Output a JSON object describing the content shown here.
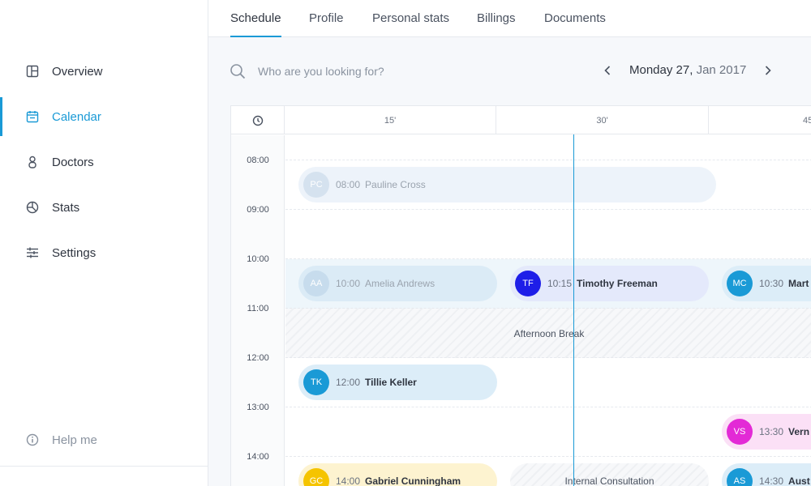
{
  "sidebar": {
    "items": [
      {
        "label": "Overview",
        "icon": "layout-icon"
      },
      {
        "label": "Calendar",
        "icon": "calendar-icon",
        "active": true
      },
      {
        "label": "Doctors",
        "icon": "person-icon"
      },
      {
        "label": "Stats",
        "icon": "pie-chart-icon"
      },
      {
        "label": "Settings",
        "icon": "sliders-icon"
      }
    ],
    "help": {
      "label": "Help me",
      "icon": "info-icon"
    }
  },
  "tabs": [
    {
      "label": "Schedule",
      "active": true
    },
    {
      "label": "Profile"
    },
    {
      "label": "Personal stats"
    },
    {
      "label": "Billings"
    },
    {
      "label": "Documents"
    }
  ],
  "search": {
    "placeholder": "Who are you looking for?",
    "value": ""
  },
  "date": {
    "day": "Monday 27,",
    "rest": "Jan 2017"
  },
  "calendar": {
    "minute_columns": [
      "15'",
      "30'",
      "45'"
    ],
    "hours": [
      "08:00",
      "09:00",
      "10:00",
      "11:00",
      "12:00",
      "13:00",
      "14:00"
    ],
    "break_label": "Afternoon Break",
    "appointments": [
      {
        "initials": "PC",
        "time": "08:00",
        "name": "Pauline Cross"
      },
      {
        "initials": "AA",
        "time": "10:00",
        "name": "Amelia Andrews"
      },
      {
        "initials": "TF",
        "time": "10:15",
        "name": "Timothy Freeman"
      },
      {
        "initials": "MC",
        "time": "10:30",
        "name": "Mart"
      },
      {
        "initials": "TK",
        "time": "12:00",
        "name": "Tillie Keller"
      },
      {
        "initials": "VS",
        "time": "13:30",
        "name": "Vern"
      },
      {
        "initials": "GC",
        "time": "14:00",
        "name": "Gabriel Cunningham"
      },
      {
        "initials": "AS",
        "time": "14:30",
        "name": "Aust"
      }
    ],
    "internal_label": "Internal Consultation"
  },
  "colors": {
    "accent": "#1a9ad6",
    "avatar_tf": "#1e1ee8",
    "avatar_mc": "#1a9ad6",
    "avatar_tk": "#1a9ad6",
    "avatar_vs": "#e32ad6",
    "avatar_gc": "#f5c400",
    "avatar_as": "#1a9ad6"
  }
}
